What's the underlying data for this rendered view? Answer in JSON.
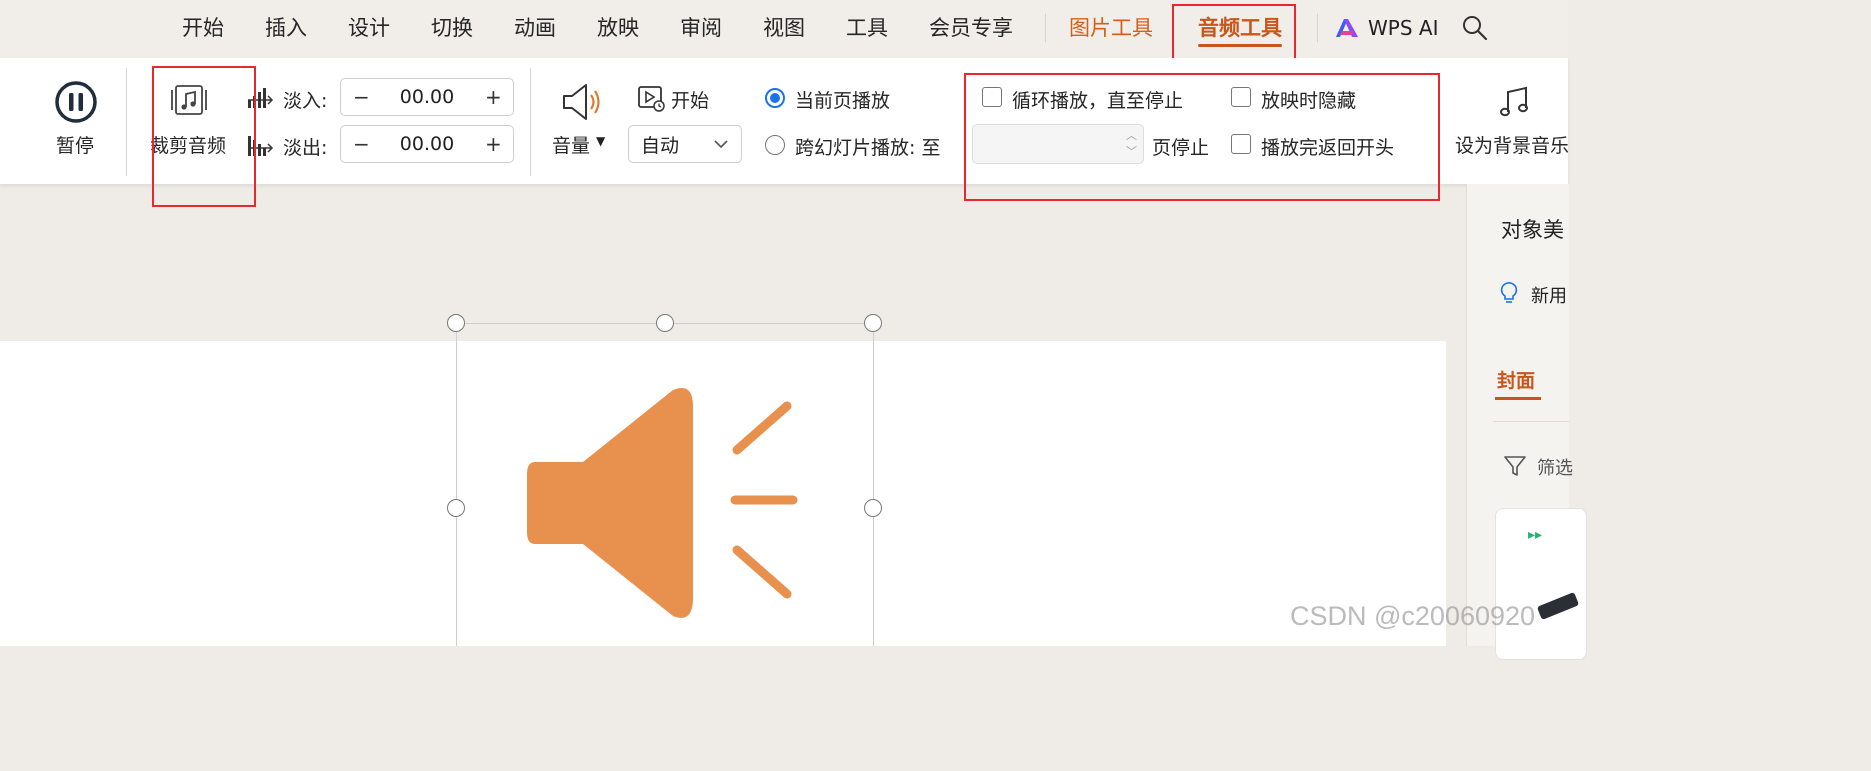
{
  "menu": {
    "items": [
      "开始",
      "插入",
      "设计",
      "切换",
      "动画",
      "放映",
      "审阅",
      "视图",
      "工具",
      "会员专享"
    ],
    "context_tabs": {
      "picture_tools": "图片工具",
      "audio_tools": "音频工具"
    },
    "wps_ai": "WPS AI",
    "search_icon": "search-icon"
  },
  "ribbon": {
    "pause_label": "暂停",
    "trim_audio_label": "裁剪音频",
    "fade_in_label": "淡入:",
    "fade_in_value": "00.00",
    "fade_out_label": "淡出:",
    "fade_out_value": "00.00",
    "volume_label": "音量",
    "start_label": "开始",
    "start_select": "自动",
    "play_current_page": "当前页播放",
    "play_across_slides": "跨幻灯片播放: 至",
    "loop_until_stopped": "循环播放，直至停止",
    "hide_during_show": "放映时隐藏",
    "stop_at_page": "页停止",
    "rewind_after_play": "播放完返回开头",
    "set_background_music": "设为背景音乐"
  },
  "right_pane": {
    "title": "对象美",
    "tip": "新用",
    "tab_cover": "封面",
    "filter": "筛选"
  },
  "watermark": "CSDN @c20060920",
  "colors": {
    "accent_orange": "#c8561a",
    "speaker_orange": "#e8904d",
    "highlight_red": "#e8282e",
    "radio_blue": "#1a73e8"
  }
}
